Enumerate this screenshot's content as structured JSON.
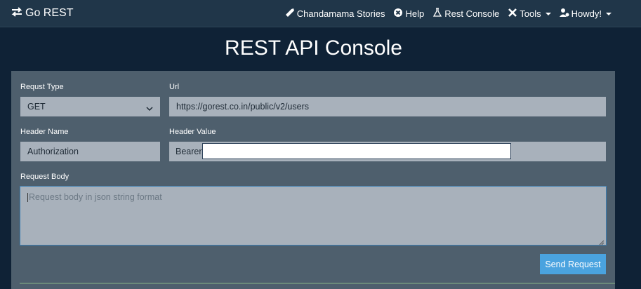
{
  "navbar": {
    "brand": "Go REST",
    "links": [
      {
        "label": "Chandamama Stories",
        "icon": "rocket-icon"
      },
      {
        "label": "Help",
        "icon": "help-circle-icon"
      },
      {
        "label": "Rest Console",
        "icon": "flask-icon"
      },
      {
        "label": "Tools",
        "icon": "tools-icon",
        "dropdown": true
      },
      {
        "label": "Howdy!",
        "icon": "user-icon",
        "dropdown": true
      }
    ]
  },
  "page": {
    "title": "REST API Console"
  },
  "form": {
    "request_type": {
      "label": "Requst Type",
      "value": "GET"
    },
    "url": {
      "label": "Url",
      "value": "https://gorest.co.in/public/v2/users"
    },
    "header_name": {
      "label": "Header Name",
      "value": "Authorization"
    },
    "header_value": {
      "label": "Header Value",
      "prefix": "Bearer",
      "token": ""
    },
    "request_body": {
      "label": "Request Body",
      "placeholder": "Request body in json string format"
    },
    "send_label": "Send Request"
  },
  "colors": {
    "navbar": "#203649",
    "background": "#0f2236",
    "card": "#4e5f6d",
    "field": "#a8b1bb",
    "accent": "#4aa3df"
  }
}
